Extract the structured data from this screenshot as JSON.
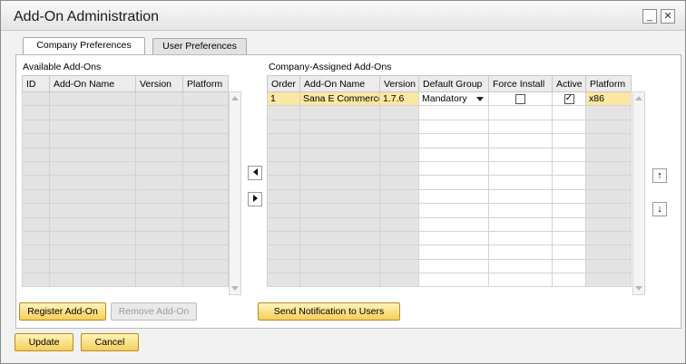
{
  "window": {
    "title": "Add-On Administration",
    "minimize_icon": "minimize-icon",
    "close_icon": "close-icon"
  },
  "tabs": [
    {
      "label": "Company Preferences",
      "active": true
    },
    {
      "label": "User Preferences",
      "active": false
    }
  ],
  "available": {
    "label": "Available Add-Ons",
    "columns": [
      "ID",
      "Add-On Name",
      "Version",
      "Platform"
    ]
  },
  "assigned": {
    "label": "Company-Assigned Add-Ons",
    "columns": [
      "Order",
      "Add-On Name",
      "Version",
      "Default Group",
      "Force Install",
      "Active",
      "Platform"
    ],
    "rows": [
      {
        "order": "1",
        "name": "Sana E Commerce",
        "version": "1.7.6",
        "default_group": "Mandatory",
        "force_install": false,
        "active": true,
        "platform": "x86"
      }
    ]
  },
  "buttons": {
    "register": "Register Add-On",
    "remove": "Remove Add-On",
    "send_notification": "Send Notification to Users",
    "update": "Update",
    "cancel": "Cancel"
  },
  "icons": {
    "move_left": "arrow-left-icon",
    "move_right": "arrow-right-icon",
    "move_up": "arrow-up-icon",
    "move_down": "arrow-down-icon"
  },
  "colors": {
    "selected_row": "#fbe7a2",
    "button_gold": "#f5cf5c",
    "grid_grey": "#e4e4e4"
  }
}
